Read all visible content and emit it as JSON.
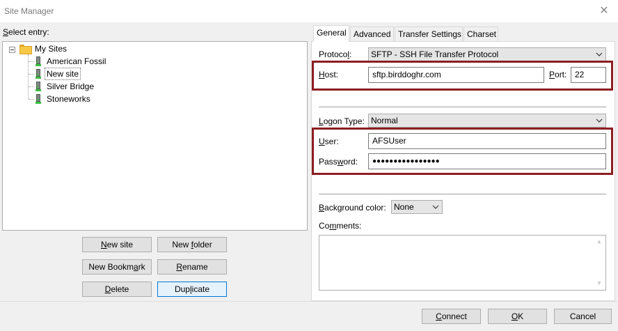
{
  "window": {
    "title": "Site Manager",
    "close_icon": "close-icon"
  },
  "left": {
    "select_prefix": "S",
    "select_rest": "elect entry:",
    "tree": {
      "root": "My Sites",
      "sites": [
        "American Fossil",
        "New site",
        "Silver Bridge",
        "Stoneworks"
      ],
      "selected_index": 1
    },
    "buttons": {
      "new_site_u": "N",
      "new_site_rest": "ew site",
      "new_folder_pre": "New ",
      "new_folder_u": "f",
      "new_folder_rest": "older",
      "new_bookmark_pre": "New Bookm",
      "new_bookmark_u": "a",
      "new_bookmark_rest": "rk",
      "rename_u": "R",
      "rename_rest": "ename",
      "delete_u": "D",
      "delete_rest": "elete",
      "duplicate_pre": "Dup",
      "duplicate_u": "l",
      "duplicate_rest": "icate"
    }
  },
  "tabs": [
    {
      "label": "General"
    },
    {
      "label": "Advanced"
    },
    {
      "label": "Transfer Settings"
    },
    {
      "label": "Charset"
    }
  ],
  "general": {
    "protocol_pre": "Protoco",
    "protocol_u": "l",
    "protocol_rest": ":",
    "protocol_value": "SFTP - SSH File Transfer Protocol",
    "host_u": "H",
    "host_rest": "ost:",
    "host_value": "sftp.birddoghr.com",
    "port_u": "P",
    "port_rest": "ort:",
    "port_value": "22",
    "logon_u": "L",
    "logon_rest": "ogon Type:",
    "logon_value": "Normal",
    "user_u": "U",
    "user_rest": "ser:",
    "user_value": "AFSUser",
    "password_pre": "Pass",
    "password_u": "w",
    "password_rest": "ord:",
    "password_value": "●●●●●●●●●●●●●●●●",
    "bgcolor_u": "B",
    "bgcolor_rest": "ackground color:",
    "bgcolor_value": "None",
    "comments_pre": "Co",
    "comments_u": "m",
    "comments_rest": "ments:"
  },
  "footer": {
    "connect_u": "C",
    "connect_rest": "onnect",
    "ok_u": "O",
    "ok_rest": "K",
    "cancel": "Cancel"
  },
  "colors": {
    "highlight_box": "#8c1d22",
    "focus_border": "#0078d7"
  }
}
